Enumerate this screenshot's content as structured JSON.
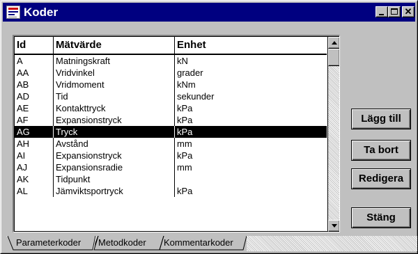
{
  "window": {
    "title": "Koder"
  },
  "table": {
    "headers": [
      "Id",
      "Mätvärde",
      "Enhet"
    ],
    "rows": [
      {
        "id": "A",
        "matvarde": "Matningskraft",
        "enhet": "kN"
      },
      {
        "id": "AA",
        "matvarde": "Vridvinkel",
        "enhet": "grader"
      },
      {
        "id": "AB",
        "matvarde": "Vridmoment",
        "enhet": "kNm"
      },
      {
        "id": "AD",
        "matvarde": "Tid",
        "enhet": "sekunder"
      },
      {
        "id": "AE",
        "matvarde": "Kontakttryck",
        "enhet": "kPa"
      },
      {
        "id": "AF",
        "matvarde": "Expansionstryck",
        "enhet": "kPa"
      },
      {
        "id": "AG",
        "matvarde": "Tryck",
        "enhet": "kPa"
      },
      {
        "id": "AH",
        "matvarde": "Avstånd",
        "enhet": "mm"
      },
      {
        "id": "AI",
        "matvarde": "Expansionstryck",
        "enhet": "kPa"
      },
      {
        "id": "AJ",
        "matvarde": "Expansionsradie",
        "enhet": "mm"
      },
      {
        "id": "AK",
        "matvarde": "Tidpunkt",
        "enhet": ""
      },
      {
        "id": "AL",
        "matvarde": "Jämviktsportryck",
        "enhet": "kPa"
      }
    ],
    "selected_row": "AG"
  },
  "buttons": {
    "add": "Lägg till",
    "remove": "Ta bort",
    "edit": "Redigera",
    "close": "Stäng"
  },
  "tabs": [
    "Parameterkoder",
    "Metodkoder",
    "Kommentarkoder"
  ],
  "colors": {
    "titlebar": "#000080",
    "selection": "#000000",
    "face": "#c0c0c0"
  },
  "icons": {
    "window_icon": "app-icon",
    "minimize": "minimize-icon",
    "maximize": "maximize-icon",
    "close": "close-icon"
  }
}
